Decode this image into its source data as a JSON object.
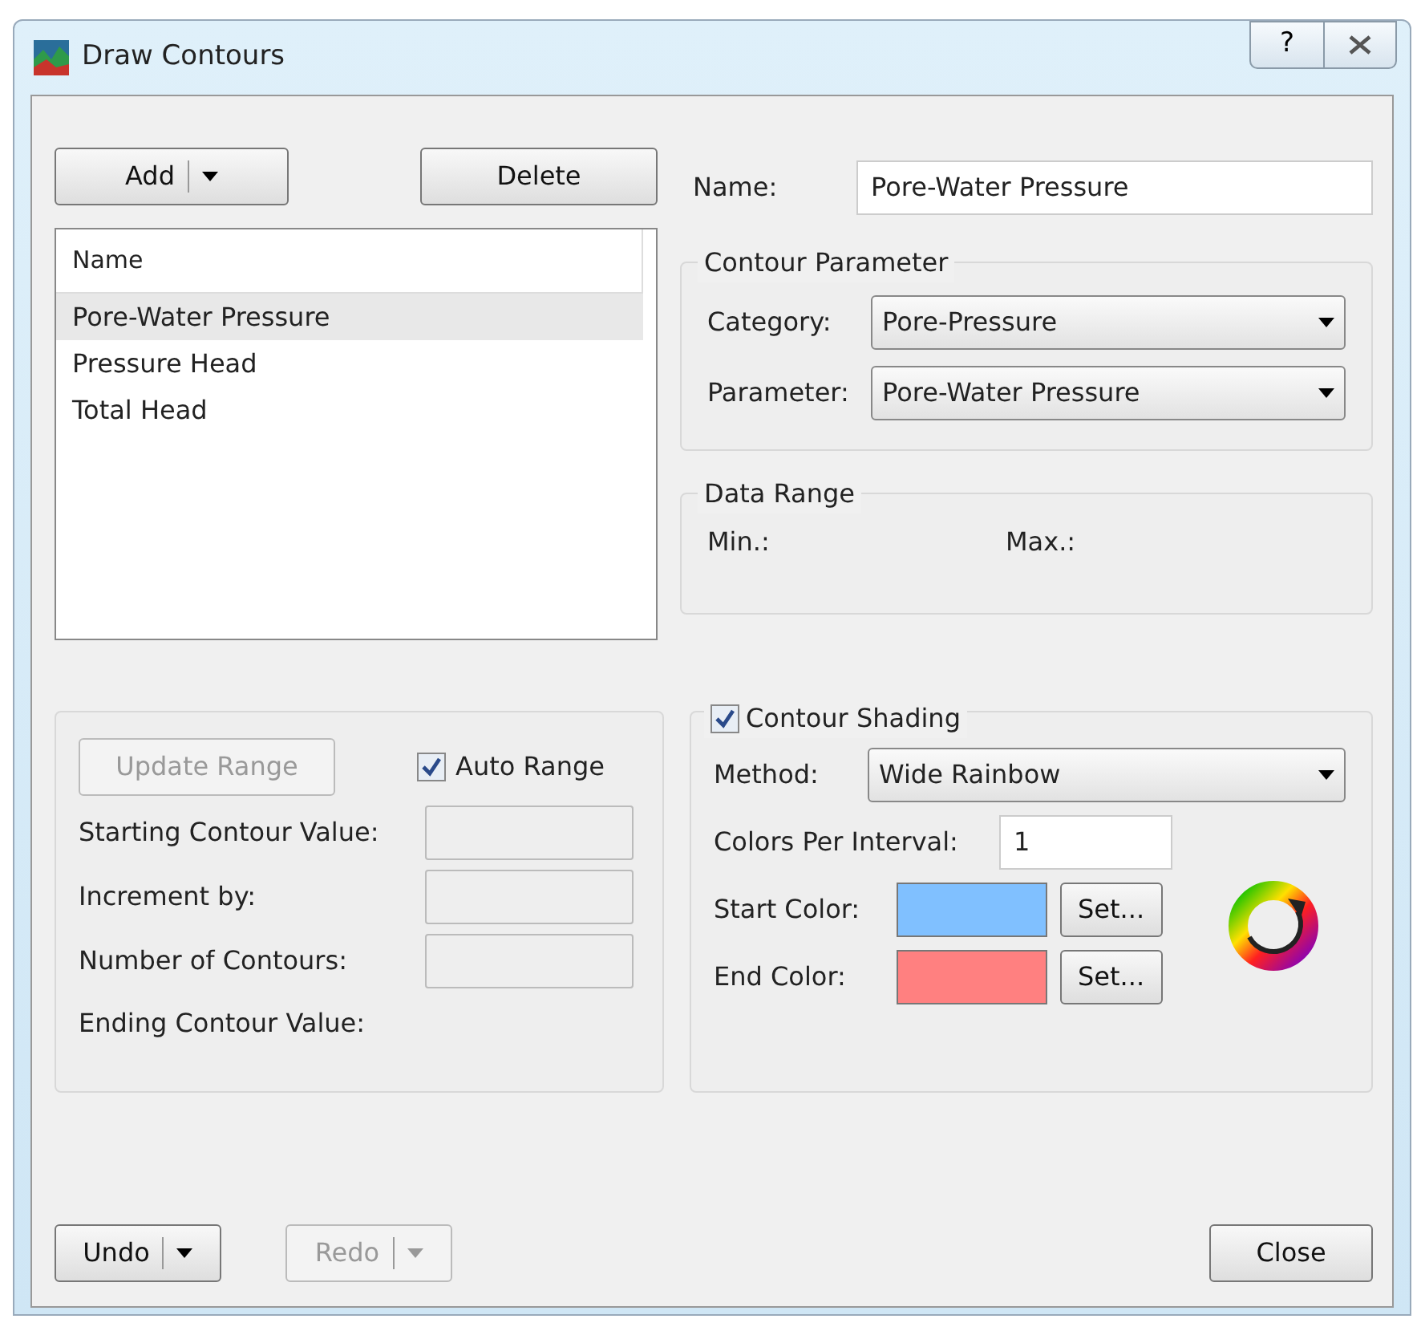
{
  "window": {
    "title": "Draw Contours",
    "help_label": "?"
  },
  "add_button": {
    "label": "Add",
    "disabled": false
  },
  "delete_button": {
    "label": "Delete",
    "disabled": false
  },
  "contour_list": {
    "header": "Name",
    "items": [
      {
        "label": "Pore-Water Pressure",
        "selected": true
      },
      {
        "label": "Pressure Head",
        "selected": false
      },
      {
        "label": "Total Head",
        "selected": false
      }
    ]
  },
  "name_field": {
    "label": "Name:",
    "value": "Pore-Water Pressure"
  },
  "contour_parameter": {
    "title": "Contour Parameter",
    "category_label": "Category:",
    "category_value": "Pore-Pressure",
    "parameter_label": "Parameter:",
    "parameter_value": "Pore-Water Pressure"
  },
  "data_range": {
    "title": "Data Range",
    "min_label": "Min.:",
    "max_label": "Max.:"
  },
  "range": {
    "update_button": {
      "label": "Update Range",
      "disabled": true
    },
    "auto_range": {
      "label": "Auto Range",
      "checked": true
    },
    "fields": [
      {
        "label": "Starting Contour Value:"
      },
      {
        "label": "Increment by:"
      },
      {
        "label": "Number of Contours:"
      }
    ],
    "ending_label": "Ending Contour Value:"
  },
  "shading": {
    "label": "Contour Shading",
    "checked": true,
    "method_label": "Method:",
    "method_value": "Wide Rainbow",
    "colors_per_interval_label": "Colors Per Interval:",
    "colors_per_interval_value": "1",
    "colors": [
      {
        "label": "Start Color:",
        "color": "#80c0ff",
        "button": "Set..."
      },
      {
        "label": "End Color:",
        "color": "#ff8080",
        "button": "Set..."
      }
    ]
  },
  "undo_button": {
    "label": "Undo",
    "disabled": false
  },
  "redo_button": {
    "label": "Redo",
    "disabled": true
  },
  "close_button": {
    "label": "Close",
    "disabled": false
  }
}
